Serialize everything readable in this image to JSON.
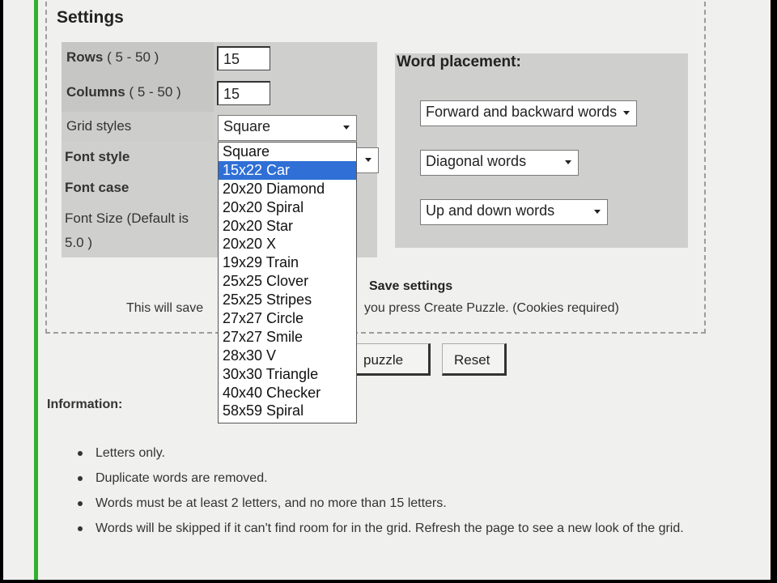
{
  "settings": {
    "title": "Settings",
    "rows_label": "Rows",
    "rows_range": "( 5 - 50 )",
    "rows_value": "15",
    "columns_label": "Columns",
    "columns_range": "( 5 - 50 )",
    "columns_value": "15",
    "grid_styles_label": "Grid styles",
    "grid_styles_value": "Square",
    "font_style_label": "Font style",
    "font_case_label": "Font case",
    "font_size_label_line1": "Font Size (Default is",
    "font_size_label_line2": "5.0 )"
  },
  "grid_styles_dropdown": {
    "selected_index": 1,
    "options": [
      "Square",
      "15x22 Car",
      "20x20 Diamond",
      "20x20 Spiral",
      "20x20 Star",
      "20x20 X",
      "19x29 Train",
      "25x25 Clover",
      "25x25 Stripes",
      "27x27 Circle",
      "27x27 Smile",
      "28x30 V",
      "30x30 Triangle",
      "40x40 Checker",
      "58x59 Spiral"
    ]
  },
  "word_placement": {
    "title": "Word placement:",
    "forward_backward": "Forward and backward words",
    "diagonal": "Diagonal words",
    "up_down": "Up and down words"
  },
  "save": {
    "label": "Save settings",
    "note_left": "This will save",
    "note_right": "you press Create Puzzle. (Cookies required)"
  },
  "buttons": {
    "create": "puzzle",
    "reset": "Reset"
  },
  "information": {
    "title": "Information:",
    "items": [
      "Letters only.",
      "Duplicate words are removed.",
      "Words must be at least 2 letters, and no more than 15 letters.",
      "Words will be skipped if it can't find room for in the grid. Refresh the page to see a new look of the grid."
    ]
  }
}
